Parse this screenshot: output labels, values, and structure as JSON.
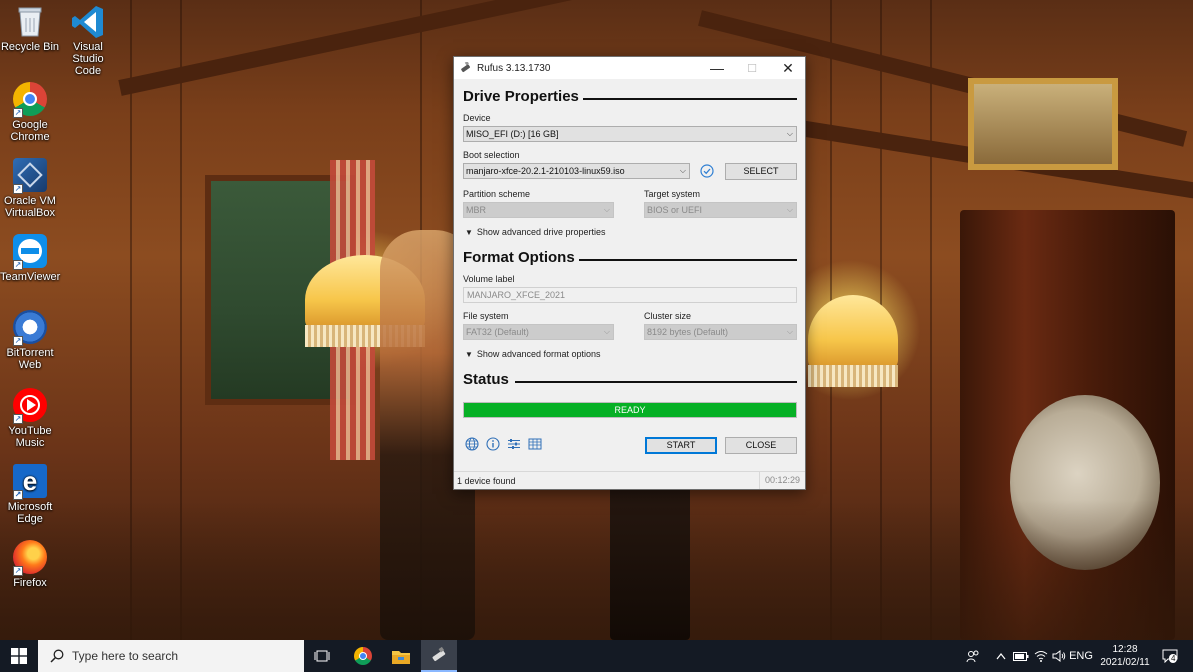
{
  "desktop": {
    "icons": [
      {
        "label": "Recycle Bin"
      },
      {
        "label": "Visual Studio Code"
      },
      {
        "label": "Google Chrome"
      },
      {
        "label": "Oracle VM VirtualBox"
      },
      {
        "label": "TeamViewer"
      },
      {
        "label": "BitTorrent Web"
      },
      {
        "label": "YouTube Music"
      },
      {
        "label": "Microsoft Edge"
      },
      {
        "label": "Firefox"
      }
    ]
  },
  "window": {
    "title": "Rufus 3.13.1730",
    "minimize_glyph": "—",
    "maximize_glyph": "☐",
    "close_glyph": "✕"
  },
  "drive_properties": {
    "heading": "Drive Properties",
    "device_label": "Device",
    "device_value": "MISO_EFI (D:) [16 GB]",
    "boot_label": "Boot selection",
    "boot_value": "manjaro-xfce-20.2.1-210103-linux59.iso",
    "select_button": "SELECT",
    "partition_label": "Partition scheme",
    "partition_value": "MBR",
    "target_label": "Target system",
    "target_value": "BIOS or UEFI",
    "advanced_toggle": "Show advanced drive properties"
  },
  "format_options": {
    "heading": "Format Options",
    "volume_label": "Volume label",
    "volume_value": "MANJARO_XFCE_2021",
    "filesystem_label": "File system",
    "filesystem_value": "FAT32 (Default)",
    "cluster_label": "Cluster size",
    "cluster_value": "8192 bytes (Default)",
    "advanced_toggle": "Show advanced format options"
  },
  "status": {
    "heading": "Status",
    "progress_text": "READY",
    "progress_fraction": 1.0,
    "progress_color": "#06b025"
  },
  "actions": {
    "start": "START",
    "close": "CLOSE",
    "tool_icons": [
      "globe-icon",
      "info-icon",
      "settings-sliders-icon",
      "log-icon"
    ]
  },
  "statusbar": {
    "left": "1 device found",
    "right": "00:12:29"
  },
  "taskbar": {
    "search_placeholder": "Type here to search",
    "apps": [
      "task-view-icon",
      "chrome-icon",
      "file-explorer-icon",
      "rufus-icon"
    ],
    "language": "ENG",
    "time": "12:28",
    "date": "2021/02/11",
    "notification_count": "4"
  }
}
